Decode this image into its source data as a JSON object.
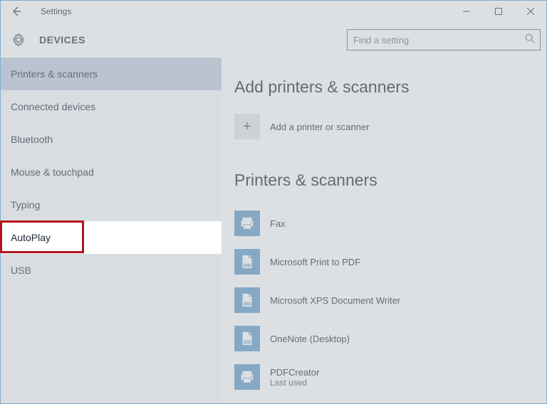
{
  "window": {
    "title": "Settings"
  },
  "header": {
    "title": "DEVICES",
    "search_placeholder": "Find a setting"
  },
  "sidebar": {
    "items": [
      {
        "label": "Printers & scanners",
        "selected": true
      },
      {
        "label": "Connected devices"
      },
      {
        "label": "Bluetooth"
      },
      {
        "label": "Mouse & touchpad"
      },
      {
        "label": "Typing"
      },
      {
        "label": "AutoPlay",
        "highlighted": true
      },
      {
        "label": "USB"
      }
    ]
  },
  "main": {
    "section1_title": "Add printers & scanners",
    "add_label": "Add a printer or scanner",
    "section2_title": "Printers & scanners",
    "devices": [
      {
        "name": "Fax",
        "icon": "printer"
      },
      {
        "name": "Microsoft Print to PDF",
        "icon": "doc"
      },
      {
        "name": "Microsoft XPS Document Writer",
        "icon": "doc"
      },
      {
        "name": "OneNote (Desktop)",
        "icon": "doc"
      },
      {
        "name": "PDFCreator",
        "sub": "Last used",
        "icon": "printer"
      }
    ]
  }
}
